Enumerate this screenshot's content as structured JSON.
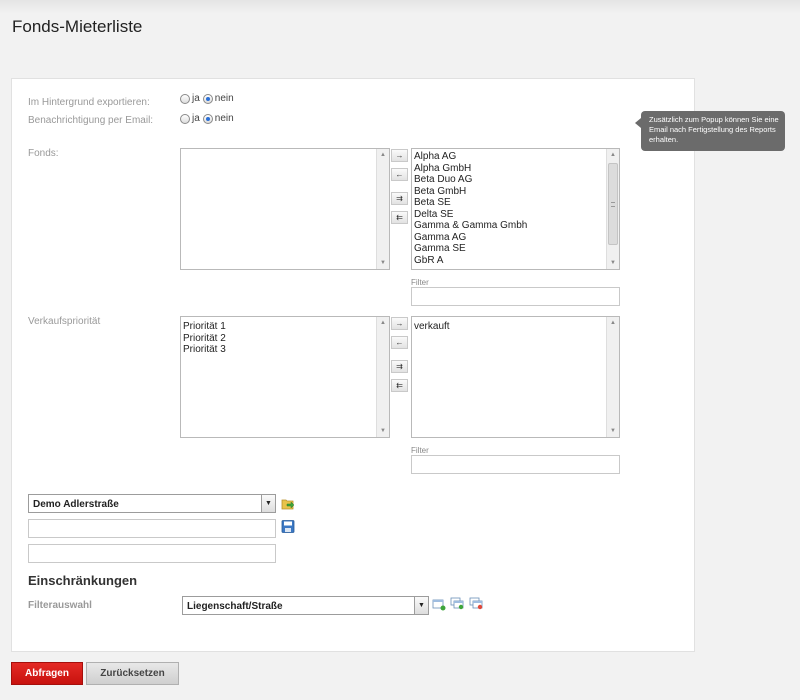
{
  "page": {
    "title": "Fonds-Mieterliste"
  },
  "form": {
    "background_export": {
      "label": "Im Hintergrund exportieren:",
      "options": [
        "ja",
        "nein"
      ],
      "selected": "nein"
    },
    "email_notification": {
      "label": "Benachrichtigung per Email:",
      "options": [
        "ja",
        "nein"
      ],
      "selected": "nein"
    },
    "tooltip": "Zusätzlich zum Popup können Sie eine Email nach Fertigstellung des Reports erhalten.",
    "fonds": {
      "label": "Fonds:",
      "selected_items": [],
      "available_items": [
        "Alpha AG",
        "Alpha GmbH",
        "Beta Duo AG",
        "Beta GmbH",
        "Beta SE",
        "Delta SE",
        "Gamma & Gamma Gmbh",
        "Gamma AG",
        "Gamma SE",
        "GbR A"
      ],
      "filter_label": "Filter",
      "filter_value": ""
    },
    "verkaufsprioritaet": {
      "label": "Verkaufspriorität",
      "selected_items": [
        "Priorität 1",
        "Priorität 2",
        "Priorität 3"
      ],
      "available_items": [
        "verkauft"
      ],
      "filter_label": "Filter",
      "filter_value": ""
    },
    "move_buttons": {
      "add": "→",
      "remove": "←",
      "add_all": "⇉",
      "remove_all": "⇇"
    },
    "template_select": {
      "value": "Demo Adlerstraße"
    },
    "template_name_value": "",
    "template_desc_value": "",
    "restrictions": {
      "title": "Einschränkungen",
      "filter_label": "Filterauswahl",
      "filter_value": "Liegenschaft/Straße"
    }
  },
  "buttons": {
    "submit": "Abfragen",
    "reset": "Zurücksetzen"
  },
  "colors": {
    "primary_button": "#d71b16",
    "radio_checked": "#2a6fd6",
    "tooltip_bg": "#6b6b6b"
  }
}
